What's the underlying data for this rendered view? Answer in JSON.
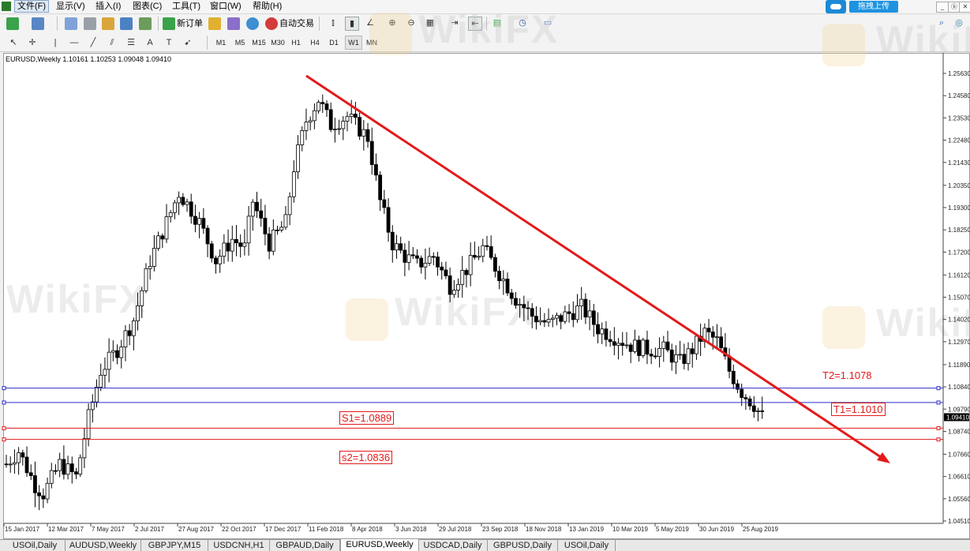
{
  "menu": [
    "文件(F)",
    "显示(V)",
    "插入(I)",
    "图表(C)",
    "工具(T)",
    "窗口(W)",
    "帮助(H)"
  ],
  "toolbar": {
    "new_order": "新订单",
    "auto_trading": "自动交易"
  },
  "upload_button": "拖拽上传",
  "window_controls": [
    "_",
    "ⓑ",
    "✕"
  ],
  "timeframes": [
    "M1",
    "M5",
    "M15",
    "M30",
    "H1",
    "H4",
    "D1",
    "W1",
    "MN"
  ],
  "selected_timeframe": "W1",
  "chart_header": "EURUSD,Weekly  1.10161 1.10253 1.09048 1.09410",
  "price_axis": [
    "1.25630",
    "1.24580",
    "1.23530",
    "1.22480",
    "1.21430",
    "1.20350",
    "1.19300",
    "1.18250",
    "1.17200",
    "1.16120",
    "1.15070",
    "1.14020",
    "1.12970",
    "1.11890",
    "1.10840",
    "1.09790",
    "1.08740",
    "1.07660",
    "1.06610",
    "1.05560",
    "1.04510"
  ],
  "current_price": "1.09410",
  "date_axis": [
    "15 Jan 2017",
    "12 Mar 2017",
    "7 May 2017",
    "2 Jul 2017",
    "27 Aug 2017",
    "22 Oct 2017",
    "17 Dec 2017",
    "11 Feb 2018",
    "8 Apr 2018",
    "3 Jun 2018",
    "29 Jul 2018",
    "23 Sep 2018",
    "18 Nov 2018",
    "13 Jan 2019",
    "10 Mar 2019",
    "5 May 2019",
    "30 Jun 2019",
    "25 Aug 2019"
  ],
  "annotations": {
    "t2": "T2=1.1078",
    "t1": "T1=1.1010",
    "s1": "S1=1.0889",
    "s2": "s2=1.0836"
  },
  "watermark": "WikiFX",
  "colors": {
    "trendline": "#e31a1a",
    "target_line": "#2d2dcc",
    "support_line": "#e31a1a",
    "candle": "#000000"
  },
  "tabs": [
    "USOil,Daily",
    "AUDUSD,Weekly",
    "GBPJPY,M15",
    "USDCNH,H1",
    "GBPAUD,Daily",
    "EURUSD,Weekly",
    "USDCAD,Daily",
    "GBPUSD,Daily",
    "USOil,Daily"
  ],
  "active_tab": "EURUSD,Weekly"
}
